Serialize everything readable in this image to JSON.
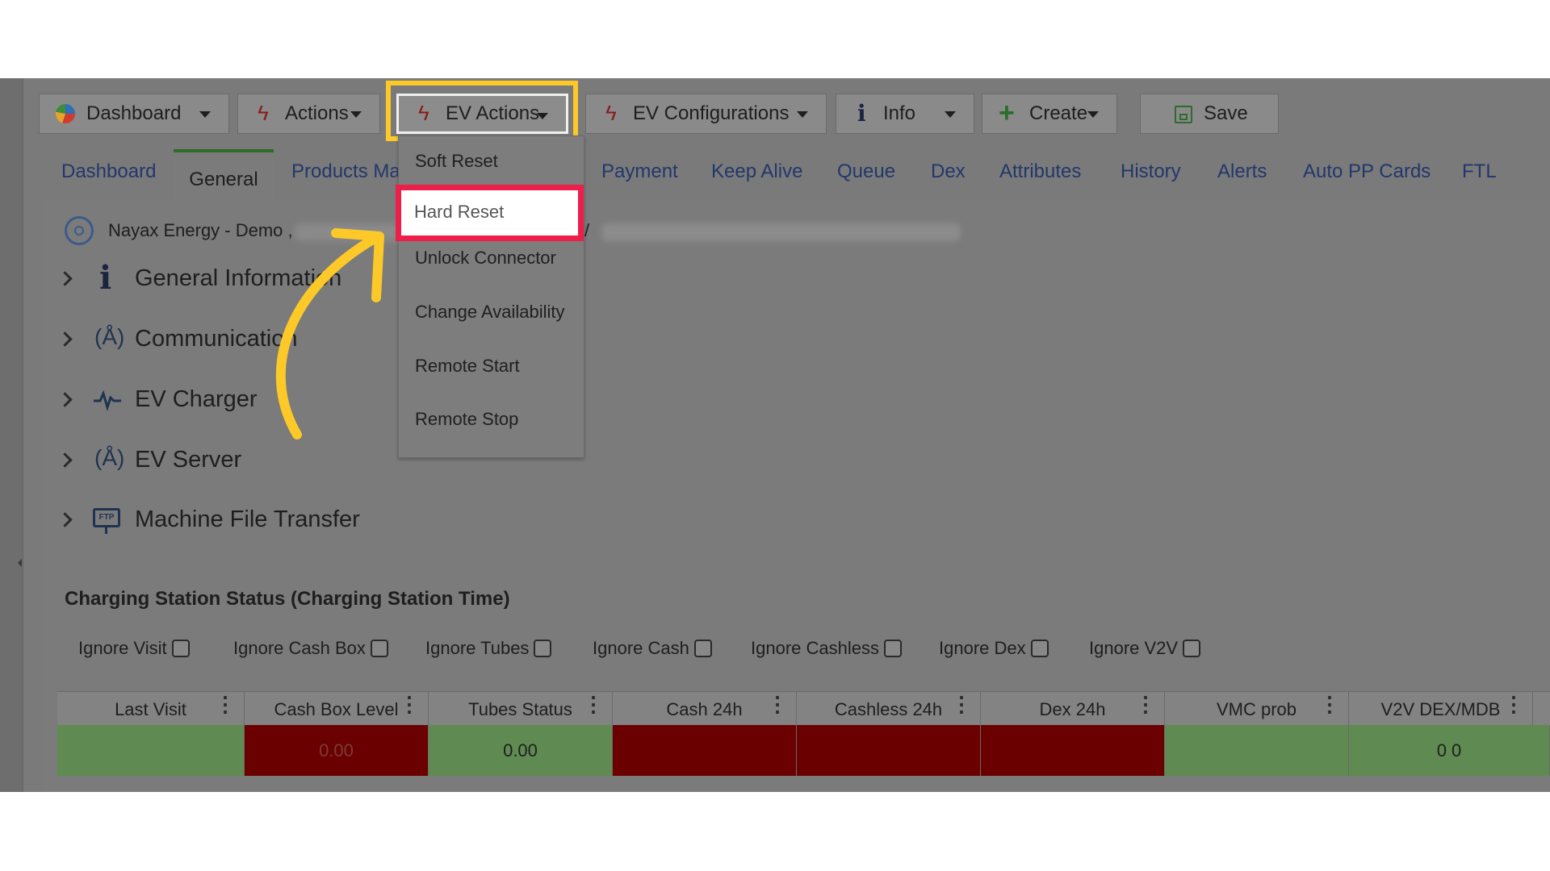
{
  "toolbar": {
    "dashboard_label": "Dashboard",
    "actions_label": "Actions",
    "ev_actions_label": "EV Actions",
    "ev_configurations_label": "EV Configurations",
    "info_label": "Info",
    "create_label": "Create",
    "save_label": "Save"
  },
  "tabs": [
    {
      "label": "Dashboard"
    },
    {
      "label": "General"
    },
    {
      "label": "Products Ma"
    },
    {
      "label": "Payment"
    },
    {
      "label": "Keep Alive"
    },
    {
      "label": "Queue"
    },
    {
      "label": "Dex"
    },
    {
      "label": "Attributes"
    },
    {
      "label": "History"
    },
    {
      "label": "Alerts"
    },
    {
      "label": "Auto PP Cards"
    },
    {
      "label": "FTL"
    }
  ],
  "breadcrumb": {
    "text": "Nayax Energy - Demo ,",
    "separator": "/"
  },
  "sections": [
    {
      "label": "General Information",
      "icon": "info-icon"
    },
    {
      "label": "Communication",
      "icon": "antenna-icon"
    },
    {
      "label": "EV Charger",
      "icon": "pulse-icon"
    },
    {
      "label": "EV Server",
      "icon": "antenna-icon"
    },
    {
      "label": "Machine File Transfer",
      "icon": "ftp-icon"
    }
  ],
  "ev_actions_menu": {
    "items": [
      "Soft Reset",
      "Hard Reset",
      "Unlock Connector",
      "Change Availability",
      "Remote Start",
      "Remote Stop"
    ],
    "highlighted": "Hard Reset"
  },
  "status": {
    "title": "Charging Station Status (Charging Station Time)",
    "filters": [
      "Ignore Visit",
      "Ignore Cash Box",
      "Ignore Tubes",
      "Ignore Cash",
      "Ignore Cashless",
      "Ignore Dex",
      "Ignore V2V"
    ],
    "columns": [
      "Last Visit",
      "Cash Box Level",
      "Tubes Status",
      "Cash 24h",
      "Cashless 24h",
      "Dex 24h",
      "VMC prob",
      "V2V DEX/MDB"
    ],
    "row": [
      "",
      "0.00",
      "0.00",
      "",
      "",
      "",
      "",
      "0 0"
    ],
    "row_status": [
      "green",
      "red",
      "green",
      "red",
      "red",
      "red",
      "green",
      "green"
    ]
  },
  "colors": {
    "highlight_yellow": "#fcc928",
    "highlight_red": "#ee1e4a",
    "status_green": "#5f8b52",
    "status_red": "#6b0000",
    "arrow_yellow": "#fcc928"
  }
}
